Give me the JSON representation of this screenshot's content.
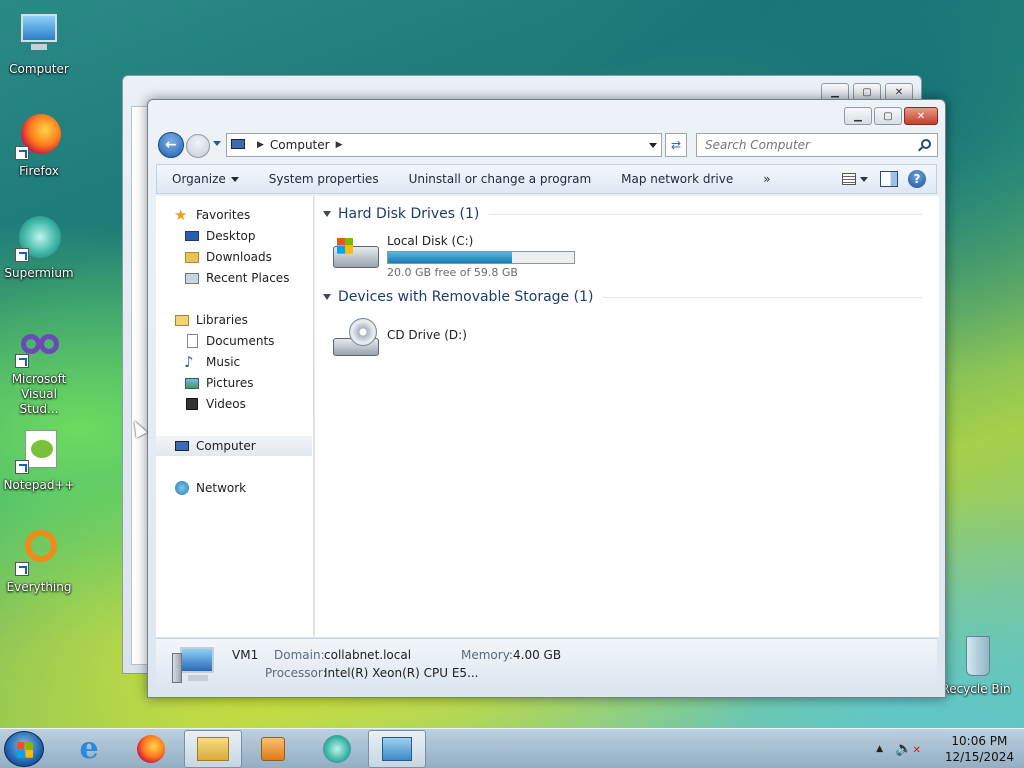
{
  "desktop": {
    "icons": [
      {
        "label": "Computer"
      },
      {
        "label": "Firefox"
      },
      {
        "label": "Supermium"
      },
      {
        "label": "Microsoft Visual Stud..."
      },
      {
        "label": "Notepad++"
      },
      {
        "label": "Everything"
      },
      {
        "label": "Recycle Bin"
      }
    ]
  },
  "window": {
    "breadcrumb": "Computer",
    "search_placeholder": "Search Computer",
    "commands": {
      "organize": "Organize",
      "system_properties": "System properties",
      "uninstall": "Uninstall or change a program",
      "map_drive": "Map network drive",
      "more": "»"
    },
    "nav": {
      "favorites": "Favorites",
      "desktop": "Desktop",
      "downloads": "Downloads",
      "recent": "Recent Places",
      "libraries": "Libraries",
      "documents": "Documents",
      "music": "Music",
      "pictures": "Pictures",
      "videos": "Videos",
      "computer": "Computer",
      "network": "Network"
    },
    "groups": {
      "hdd": "Hard Disk Drives (1)",
      "removable": "Devices with Removable Storage (1)"
    },
    "drives": {
      "c_name": "Local Disk (C:)",
      "c_free": "20.0 GB free of 59.8 GB",
      "c_used_fraction": 0.665,
      "d_name": "CD Drive (D:)"
    },
    "details": {
      "name": "VM1",
      "domain_label": "Domain:",
      "domain_value": "collabnet.local",
      "memory_label": "Memory:",
      "memory_value": "4.00 GB",
      "processor_label": "Processor:",
      "processor_value": "Intel(R) Xeon(R) CPU E5..."
    }
  },
  "taskbar": {
    "time": "10:06 PM",
    "date": "12/15/2024"
  }
}
